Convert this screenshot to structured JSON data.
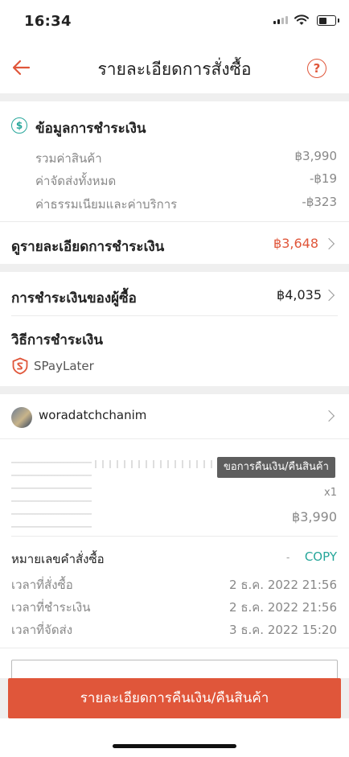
{
  "status_bar": {
    "time": "16:34"
  },
  "header": {
    "title": "รายละเอียดการสั่งซื้อ",
    "help_icon": "help-circle-icon",
    "back_icon": "arrow-left-icon"
  },
  "payment_info": {
    "title": "ข้อมูลการชำระเงิน",
    "rows": [
      {
        "label": "รวมค่าสินค้า",
        "value": "฿3,990"
      },
      {
        "label": "ค่าจัดส่งทั้งหมด",
        "value": "-฿19"
      },
      {
        "label": "ค่าธรรมเนียมและค่าบริการ",
        "value": "-฿323"
      }
    ],
    "detail_link": {
      "label": "ดูรายละเอียดการชำระเงิน",
      "value": "฿3,648"
    }
  },
  "buyer_payment": {
    "label": "การชำระเงินของผู้ซื้อ",
    "value": "฿4,035"
  },
  "payment_method": {
    "title": "วิธีการชำระเงิน",
    "value": "SPayLater"
  },
  "buyer": {
    "username": "woradatchchanim"
  },
  "product": {
    "tag": "ขอการคืนเงิน/คืนสินค้า",
    "qty": "x1",
    "price": "฿3,990"
  },
  "order_info": {
    "order_no_label": "หมายเลขคำสั่งซื้อ",
    "copy_label": "COPY",
    "rows": [
      {
        "label": "เวลาที่สั่งซื้อ",
        "value": "2 ธ.ค. 2022 21:56"
      },
      {
        "label": "เวลาที่ชำระเงิน",
        "value": "2 ธ.ค. 2022 21:56"
      },
      {
        "label": "เวลาที่จัดส่ง",
        "value": "3 ธ.ค. 2022 15:20"
      }
    ]
  },
  "cta": {
    "label": "รายละเอียดการคืนเงิน/คืนสินค้า"
  },
  "colors": {
    "accent": "#e0563a",
    "teal": "#26a69a"
  }
}
